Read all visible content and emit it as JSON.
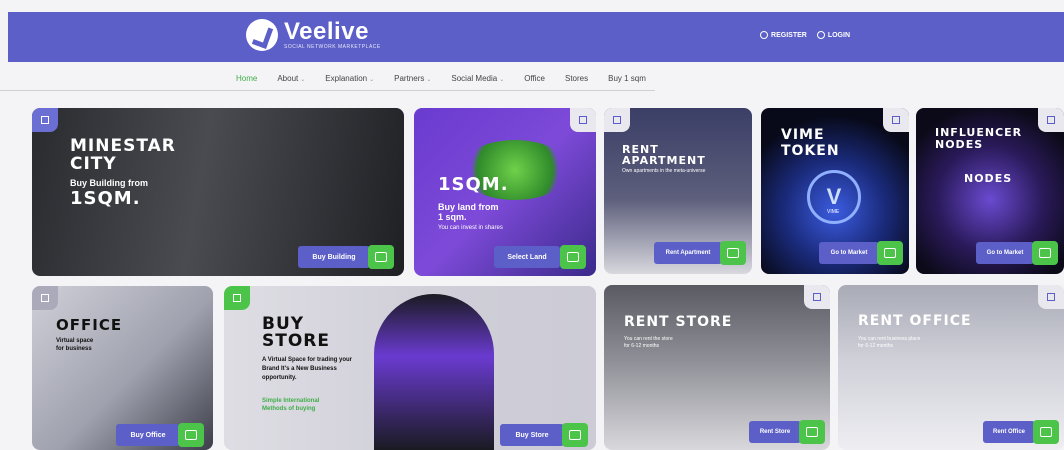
{
  "header": {
    "brand": "Veelive",
    "tagline": "SOCIAL NETWORK MARKETPLACE",
    "register": "REGISTER",
    "login": "LOGIN"
  },
  "nav": [
    "Home",
    "About",
    "Explanation",
    "Partners",
    "Social Media",
    "Office",
    "Stores",
    "Buy 1 sqm"
  ],
  "cards": {
    "minestar": {
      "title1": "MINESTAR",
      "title2": "CITY",
      "sub1": "Buy Building from",
      "sub2": "1SQM.",
      "button": "Buy Building"
    },
    "land": {
      "title": "1SQM.",
      "sub1": "Buy land from",
      "sub2": "1 sqm.",
      "note": "You can invest in shares",
      "button": "Select Land"
    },
    "rentapt": {
      "title1": "RENT",
      "title2": "APARTMENT",
      "sub": "Own apartments in the meta-universe",
      "button": "Rent Apartment"
    },
    "vime": {
      "title1": "VIME",
      "title2": "TOKEN",
      "coin": "VIME",
      "button": "Go to Market"
    },
    "influencer": {
      "title1": "INFLUENCER",
      "title2": "NODES",
      "badge": "NODES",
      "button": "Go to Market"
    },
    "office": {
      "title": "OFFICE",
      "sub1": "Virtual space",
      "sub2": "for business",
      "button": "Buy Office"
    },
    "buystore": {
      "title1": "BUY",
      "title2": "STORE",
      "sub1": "A Virtual Space for trading your",
      "sub2": "Brand It's a New Business",
      "sub3": "opportunity.",
      "highlight1": "Simple International",
      "highlight2": "Methods of buying",
      "button": "Buy Store"
    },
    "rentstore": {
      "title": "RENT STORE",
      "sub1": "You can rent the store",
      "sub2": "for 6-12 months",
      "button": "Rent Store"
    },
    "rentoffice": {
      "title": "RENT OFFICE",
      "sub1": "You can rent business place",
      "sub2": "for 6-12 months",
      "button": "Rent Office"
    }
  },
  "colors": {
    "brand": "#5b5fc7",
    "accent": "#4cc44a"
  }
}
